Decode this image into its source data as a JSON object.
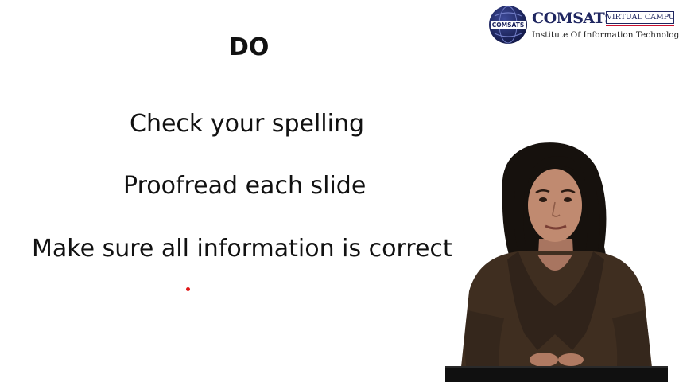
{
  "slide": {
    "heading": "DO",
    "points": [
      "Check your spelling",
      "Proofread each slide",
      "Make sure all information is correct"
    ]
  },
  "logo": {
    "globe_label": "COMSATS",
    "name": "COMSATS",
    "badge": "VIRTUAL CAMPUS",
    "subtitle": "Institute Of Information Technology"
  },
  "colors": {
    "logo_navy": "#1f2660",
    "logo_red": "#c8102e",
    "laser": "#e01515"
  },
  "icons": {
    "logo_mark": "comsats-globe-icon",
    "laser_pointer": "laser-pointer-dot"
  }
}
